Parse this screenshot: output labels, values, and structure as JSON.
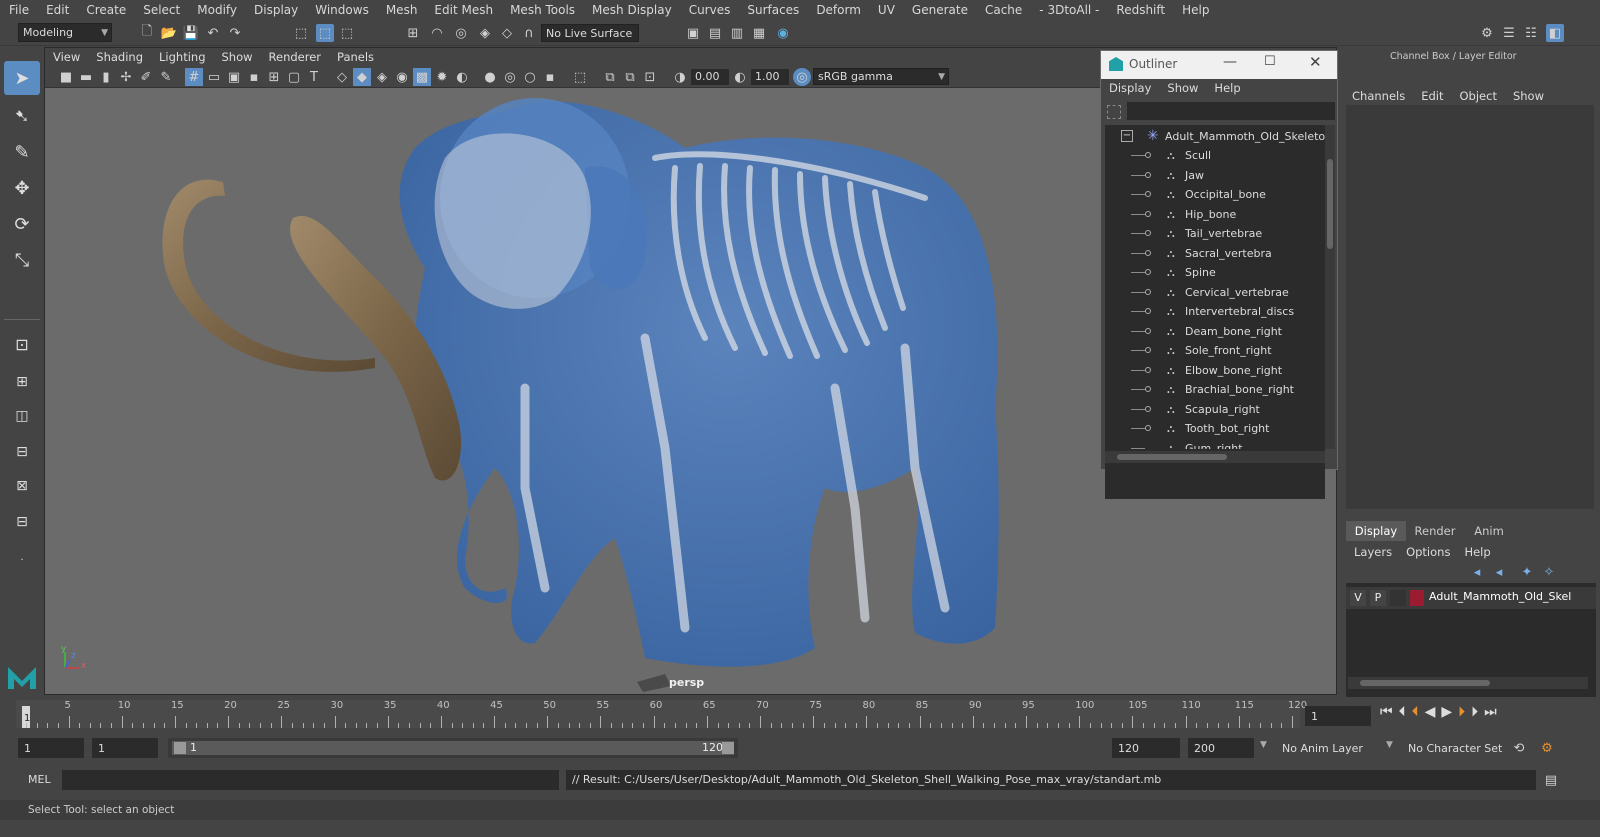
{
  "menubar": {
    "items": [
      "File",
      "Edit",
      "Create",
      "Select",
      "Modify",
      "Display",
      "Windows",
      "Mesh",
      "Edit Mesh",
      "Mesh Tools",
      "Mesh Display",
      "Curves",
      "Surfaces",
      "Deform",
      "UV",
      "Generate",
      "Cache",
      "- 3DtoAll -",
      "Redshift",
      "Help"
    ]
  },
  "shelf": {
    "mode": "Modeling",
    "live_surface": "No Live Surface"
  },
  "viewport": {
    "menu": [
      "View",
      "Shading",
      "Lighting",
      "Show",
      "Renderer",
      "Panels"
    ],
    "exposure": "0.00",
    "gamma": "1.00",
    "color_space": "sRGB gamma",
    "camera_label": "persp",
    "axis_x": "x",
    "axis_y": "y",
    "axis_z": "z"
  },
  "outliner": {
    "title": "Outliner",
    "menu": [
      "Display",
      "Show",
      "Help"
    ],
    "root": "Adult_Mammoth_Old_Skeleton_",
    "items": [
      "Scull",
      "Jaw",
      "Occipital_bone",
      "Hip_bone",
      "Tail_vertebrae",
      "Sacral_vertebra",
      "Spine",
      "Cervical_vertebrae",
      "Intervertebral_discs",
      "Deam_bone_right",
      "Sole_front_right",
      "Elbow_bone_right",
      "Brachial_bone_right",
      "Scapula_right",
      "Tooth_bot_right",
      "Gum_right"
    ]
  },
  "channel_box": {
    "title": "Channel Box / Layer Editor",
    "menu": [
      "Channels",
      "Edit",
      "Object",
      "Show"
    ]
  },
  "layer_editor": {
    "tabs": [
      "Display",
      "Render",
      "Anim"
    ],
    "active_tab": "Display",
    "menu": [
      "Layers",
      "Options",
      "Help"
    ],
    "layer": {
      "v": "V",
      "p": "P",
      "name": "Adult_Mammoth_Old_Skel",
      "color": "#9b1b30"
    }
  },
  "timeline": {
    "ticks": [
      "5",
      "10",
      "15",
      "20",
      "25",
      "30",
      "35",
      "40",
      "45",
      "50",
      "55",
      "60",
      "65",
      "70",
      "75",
      "80",
      "85",
      "90",
      "95",
      "100",
      "105",
      "110",
      "115",
      "120"
    ],
    "current_frame": "1",
    "current_frame_field": "1"
  },
  "range": {
    "start": "1",
    "start_inner": "1",
    "slider_start": "1",
    "slider_end": "120",
    "end_inner": "120",
    "end": "200",
    "anim_layer": "No Anim Layer",
    "character_set": "No Character Set"
  },
  "command_line": {
    "lang": "MEL",
    "result": "// Result: C:/Users/User/Desktop/Adult_Mammoth_Old_Skeleton_Shell_Walking_Pose_max_vray/standart.mb"
  },
  "status": {
    "help_line": "Select Tool: select an object"
  },
  "colors": {
    "mammoth_body": "#3f6db0",
    "tusk": "#8a7558",
    "bone": "#d8dde6",
    "viewport_bg": "#6b6b6b",
    "selected_tool": "#5b8dc2",
    "maya_logo": "#22a0a8"
  }
}
